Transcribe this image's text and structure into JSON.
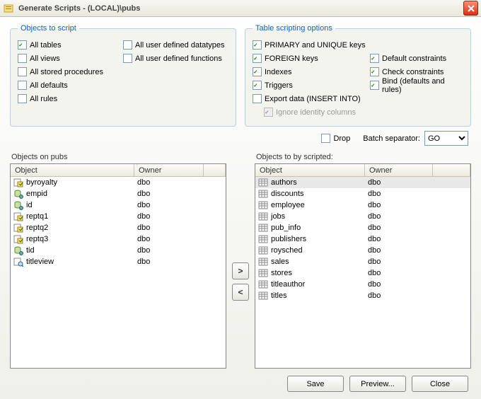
{
  "window": {
    "title": "Generate Scripts - (LOCAL)\\pubs"
  },
  "objects_to_script": {
    "legend": "Objects to script",
    "all_tables": {
      "label": "All tables",
      "checked": true
    },
    "all_views": {
      "label": "All views",
      "checked": false
    },
    "all_stored_procedures": {
      "label": "All stored procedures",
      "checked": false
    },
    "all_defaults": {
      "label": "All defaults",
      "checked": false
    },
    "all_rules": {
      "label": "All rules",
      "checked": false
    },
    "all_user_defined_datatypes": {
      "label": "All user defined datatypes",
      "checked": false
    },
    "all_user_defined_functions": {
      "label": "All user defined functions",
      "checked": false
    }
  },
  "table_scripting": {
    "legend": "Table scripting options",
    "primary_unique": {
      "label": "PRIMARY and UNIQUE keys",
      "checked": true
    },
    "foreign_keys": {
      "label": "FOREIGN keys",
      "checked": true
    },
    "indexes": {
      "label": "Indexes",
      "checked": true
    },
    "triggers": {
      "label": "Triggers",
      "checked": true
    },
    "export_data": {
      "label": "Export data (INSERT INTO)",
      "checked": false
    },
    "ignore_identity": {
      "label": "Ignore identity columns",
      "checked": true,
      "disabled": true
    },
    "default_constraints": {
      "label": "Default constraints",
      "checked": true
    },
    "check_constraints": {
      "label": "Check constraints",
      "checked": true
    },
    "bind": {
      "label": "Bind (defaults and rules)",
      "checked": true
    }
  },
  "drop": {
    "label": "Drop",
    "checked": false
  },
  "batch_separator": {
    "label": "Batch separator:",
    "value": "GO"
  },
  "left_list": {
    "title": "Objects on pubs",
    "headers": {
      "object": "Object",
      "owner": "Owner"
    },
    "rows": [
      {
        "icon": "proc",
        "object": "byroyalty",
        "owner": "dbo"
      },
      {
        "icon": "type",
        "object": "empid",
        "owner": "dbo"
      },
      {
        "icon": "type",
        "object": "id",
        "owner": "dbo"
      },
      {
        "icon": "proc",
        "object": "reptq1",
        "owner": "dbo"
      },
      {
        "icon": "proc",
        "object": "reptq2",
        "owner": "dbo"
      },
      {
        "icon": "proc",
        "object": "reptq3",
        "owner": "dbo"
      },
      {
        "icon": "type",
        "object": "tid",
        "owner": "dbo"
      },
      {
        "icon": "view",
        "object": "titleview",
        "owner": "dbo"
      }
    ]
  },
  "right_list": {
    "title": "Objects to by scripted:",
    "headers": {
      "object": "Object",
      "owner": "Owner"
    },
    "rows": [
      {
        "icon": "table",
        "object": "authors",
        "owner": "dbo",
        "selected": true
      },
      {
        "icon": "table",
        "object": "discounts",
        "owner": "dbo"
      },
      {
        "icon": "table",
        "object": "employee",
        "owner": "dbo"
      },
      {
        "icon": "table",
        "object": "jobs",
        "owner": "dbo"
      },
      {
        "icon": "table",
        "object": "pub_info",
        "owner": "dbo"
      },
      {
        "icon": "table",
        "object": "publishers",
        "owner": "dbo"
      },
      {
        "icon": "table",
        "object": "roysched",
        "owner": "dbo"
      },
      {
        "icon": "table",
        "object": "sales",
        "owner": "dbo"
      },
      {
        "icon": "table",
        "object": "stores",
        "owner": "dbo"
      },
      {
        "icon": "table",
        "object": "titleauthor",
        "owner": "dbo"
      },
      {
        "icon": "table",
        "object": "titles",
        "owner": "dbo"
      }
    ]
  },
  "buttons": {
    "save": "Save",
    "preview": "Preview...",
    "close": "Close",
    "move_right": ">",
    "move_left": "<"
  }
}
